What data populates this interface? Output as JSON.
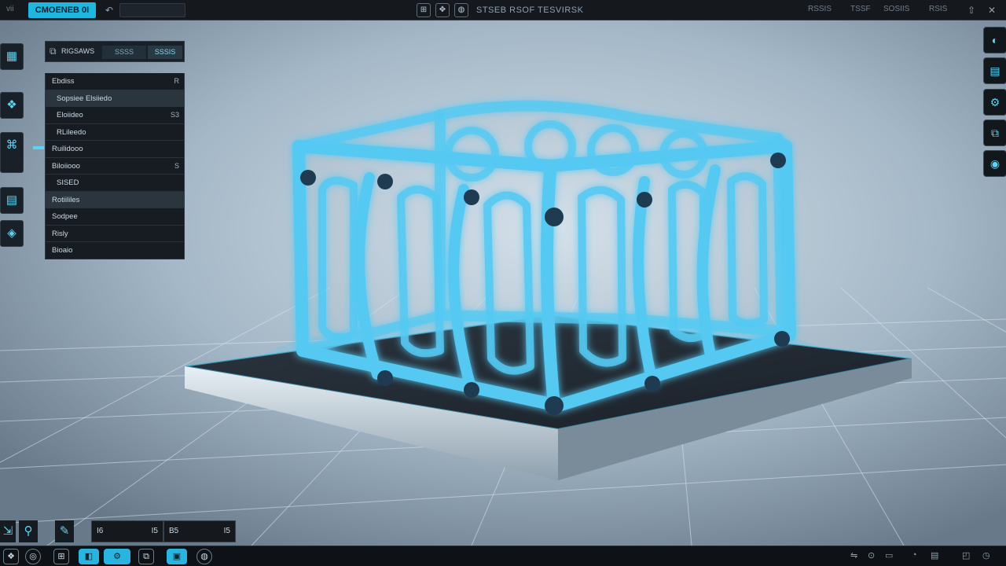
{
  "window": {
    "app_title": "CMOENEB 0I",
    "menu_left": "vii",
    "doc_title": "STSEB RSOF TESVIRSK",
    "menu_right": [
      "RSSIS",
      "TSSF",
      "SOSIIS",
      "RSIS"
    ]
  },
  "outliner": {
    "tab_label": "RIGSAWS",
    "filter_a": "SSSS",
    "filter_b": "SSSIS",
    "items": [
      {
        "label": "Ebdiss",
        "end": "R"
      },
      {
        "label": "Sopsiee Elsiiedo",
        "end": ""
      },
      {
        "label": "Eloiideo",
        "end": "S3"
      },
      {
        "label": "RLileedo",
        "end": ""
      },
      {
        "label": "Ruilidooo",
        "end": ""
      },
      {
        "label": "Biloiiooo",
        "end": "S"
      },
      {
        "label": "SISED",
        "end": ""
      },
      {
        "label": "Rotiililes",
        "end": ""
      },
      {
        "label": "Sodpee",
        "end": ""
      },
      {
        "label": "Risly",
        "end": ""
      },
      {
        "label": "Bioaio",
        "end": ""
      }
    ]
  },
  "status": {
    "field_a": {
      "value": "I6",
      "end": "I5"
    },
    "field_b": {
      "value": "B5",
      "end": "I5"
    }
  },
  "icons": {
    "left_strip": [
      "grid-icon",
      "layers-icon",
      "transform-icon",
      "modifier-icon",
      "material-icon"
    ],
    "right_strip": [
      "viewport-icon",
      "render-icon",
      "physics-icon",
      "mesh-icon",
      "settings-icon"
    ],
    "taskbar": [
      "start-icon",
      "files-icon",
      "app-icon",
      "sculpt-icon",
      "grid-app-icon",
      "media-icon",
      "browser-icon"
    ]
  },
  "colors": {
    "accent": "#2ab5e0",
    "lattice": "#54c8f0",
    "topbar": "#15191e",
    "panel": "#161c22"
  }
}
